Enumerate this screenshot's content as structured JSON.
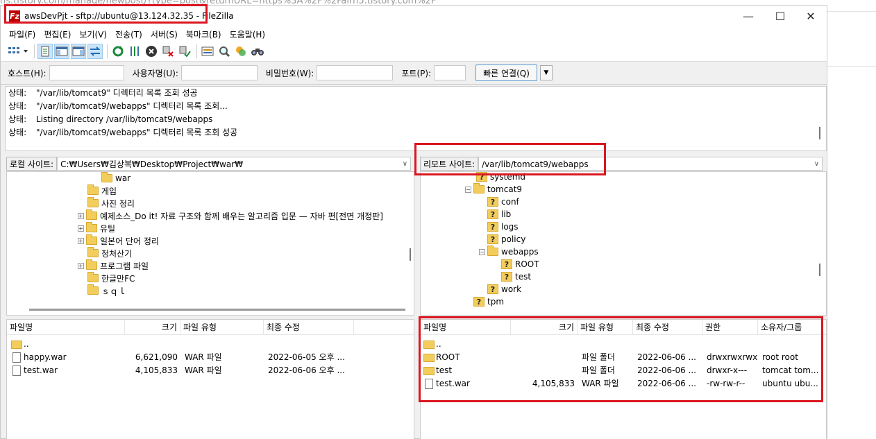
{
  "browser_url_fragment": "ns.tistory.com/manage/newpost/?type=post&returnURL=https%3A%2F%2Fairn5.tistory.com%2F",
  "window": {
    "title": "awsDevPjt - sftp://ubuntu@13.124.32.35 - FileZilla",
    "icon_letter": "Fz",
    "minimize": "—",
    "maximize": "☐",
    "close": "✕"
  },
  "menu": [
    "파일(F)",
    "편집(E)",
    "보기(V)",
    "전송(T)",
    "서버(S)",
    "북마크(B)",
    "도움말(H)"
  ],
  "quickconnect": {
    "host_label": "호스트(H):",
    "user_label": "사용자명(U):",
    "pass_label": "비밀번호(W):",
    "port_label": "포트(P):",
    "connect_label": "빠른 연결(Q)"
  },
  "log": [
    {
      "key": "상태:",
      "msg": "\"/var/lib/tomcat9\" 디렉터리 목록 조회 성공"
    },
    {
      "key": "상태:",
      "msg": "\"/var/lib/tomcat9/webapps\" 디렉터리 목록 조회..."
    },
    {
      "key": "상태:",
      "msg": "Listing directory /var/lib/tomcat9/webapps"
    },
    {
      "key": "상태:",
      "msg": "\"/var/lib/tomcat9/webapps\" 디렉터리 목록 조회 성공"
    }
  ],
  "local": {
    "site_label": "로컬 사이트:",
    "path": "C:₩Users₩김상복₩Desktop₩Project₩war₩",
    "tree": [
      "war",
      "게임",
      "사진 정리",
      "예제소스_Do it! 자료 구조와 함께 배우는 알고리즘 입문 — 자바 편[전면 개정판]",
      "유틸",
      "일본어 단어 정리",
      "정처산기",
      "프로그램 파일",
      "한글만FC",
      "ｓｑｌ"
    ],
    "columns": [
      "파일명",
      "크기",
      "파일 유형",
      "최종 수정"
    ],
    "files": [
      {
        "name": "..",
        "size": "",
        "type": "",
        "modified": ""
      },
      {
        "name": "happy.war",
        "size": "6,621,090",
        "type": "WAR 파일",
        "modified": "2022-06-05 오후 ..."
      },
      {
        "name": "test.war",
        "size": "4,105,833",
        "type": "WAR 파일",
        "modified": "2022-06-06 오후 ..."
      }
    ]
  },
  "remote": {
    "site_label": "리모트 사이트:",
    "path": "/var/lib/tomcat9/webapps",
    "tree": [
      "systemd",
      "tomcat9",
      "conf",
      "lib",
      "logs",
      "policy",
      "webapps",
      "ROOT",
      "test",
      "work",
      "tpm"
    ],
    "columns": [
      "파일명",
      "크기",
      "파일 유형",
      "최종 수정",
      "권한",
      "소유자/그룹"
    ],
    "files": [
      {
        "name": "..",
        "size": "",
        "type": "",
        "modified": "",
        "perm": "",
        "owner": ""
      },
      {
        "name": "ROOT",
        "size": "",
        "type": "파일 폴더",
        "modified": "2022-06-06 ...",
        "perm": "drwxrwxrwx",
        "owner": "root root"
      },
      {
        "name": "test",
        "size": "",
        "type": "파일 폴더",
        "modified": "2022-06-06 ...",
        "perm": "drwxr-x---",
        "owner": "tomcat tom..."
      },
      {
        "name": "test.war",
        "size": "4,105,833",
        "type": "WAR 파일",
        "modified": "2022-06-06 ...",
        "perm": "-rw-rw-r--",
        "owner": "ubuntu ubu..."
      }
    ]
  },
  "icons": [
    "site-manager-icon",
    "toggle-log-icon",
    "toggle-local-tree-icon",
    "toggle-remote-tree-icon",
    "transfer-queue-icon",
    "refresh-icon",
    "process-queue-icon",
    "cancel-icon",
    "disconnect-icon",
    "reconnect-icon",
    "filter-icon",
    "search-icon",
    "compare-icon",
    "find-icon"
  ],
  "colors": {
    "highlight": "#d9161f",
    "folder": "#f3cd5b"
  }
}
